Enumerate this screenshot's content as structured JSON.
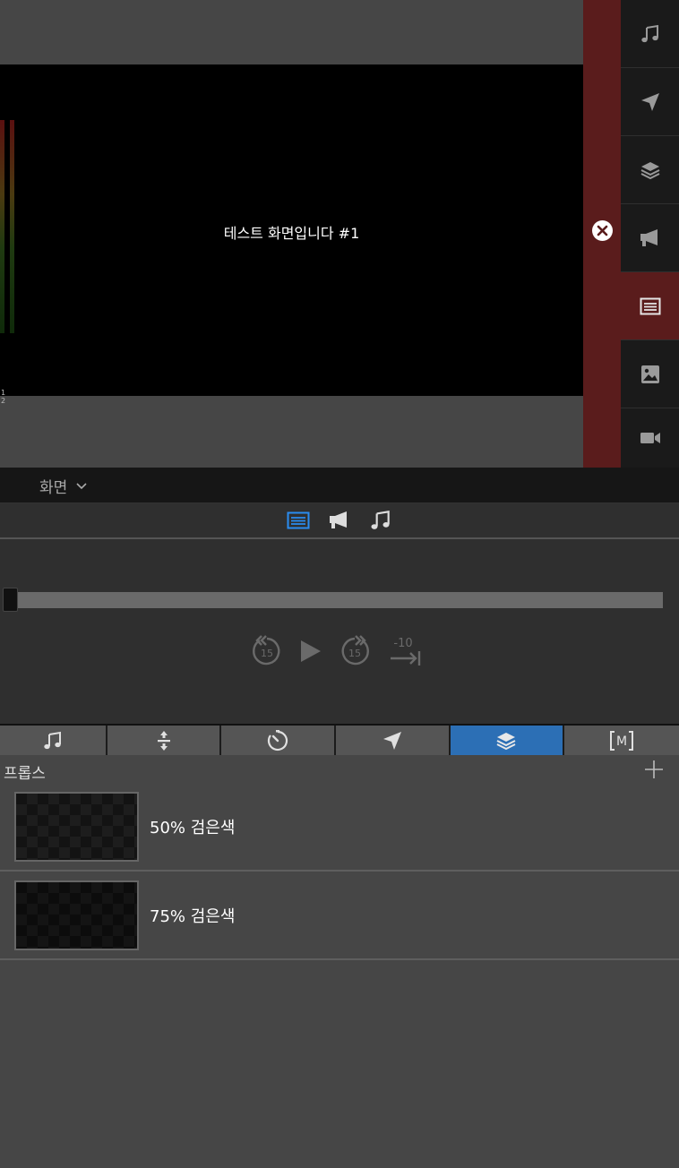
{
  "preview": {
    "screen_text": "테스트 화면입니다 #1",
    "meter_labels": "1 2"
  },
  "sidebar": {
    "items": [
      {
        "name": "music",
        "icon": "music-note-icon"
      },
      {
        "name": "send",
        "icon": "paper-plane-icon"
      },
      {
        "name": "layers",
        "icon": "layers-icon"
      },
      {
        "name": "announce",
        "icon": "megaphone-icon"
      },
      {
        "name": "text",
        "icon": "text-lines-icon",
        "active": true
      },
      {
        "name": "image",
        "icon": "image-icon"
      },
      {
        "name": "video",
        "icon": "video-camera-icon"
      }
    ]
  },
  "screen_bar": {
    "selected": "화면"
  },
  "player": {
    "tabs": [
      "text-lines-icon",
      "megaphone-icon",
      "music-note-icon"
    ],
    "progress": 0,
    "rewind_label": "15",
    "forward_label": "15",
    "skip_label": "-10"
  },
  "bottom_tabs": [
    {
      "icon": "music-note-icon"
    },
    {
      "icon": "split-icon"
    },
    {
      "icon": "timer-icon"
    },
    {
      "icon": "paper-plane-icon"
    },
    {
      "icon": "layers-icon",
      "active": true
    },
    {
      "icon": "macro-icon",
      "label": "M"
    }
  ],
  "props": {
    "title": "프롭스",
    "items": [
      {
        "label": "50% 검은색"
      },
      {
        "label": "75% 검은색"
      }
    ]
  },
  "colors": {
    "accent_red": "#5a1c1c",
    "accent_blue": "#2c6fb5",
    "active_icon_blue": "#2a8cf0"
  }
}
